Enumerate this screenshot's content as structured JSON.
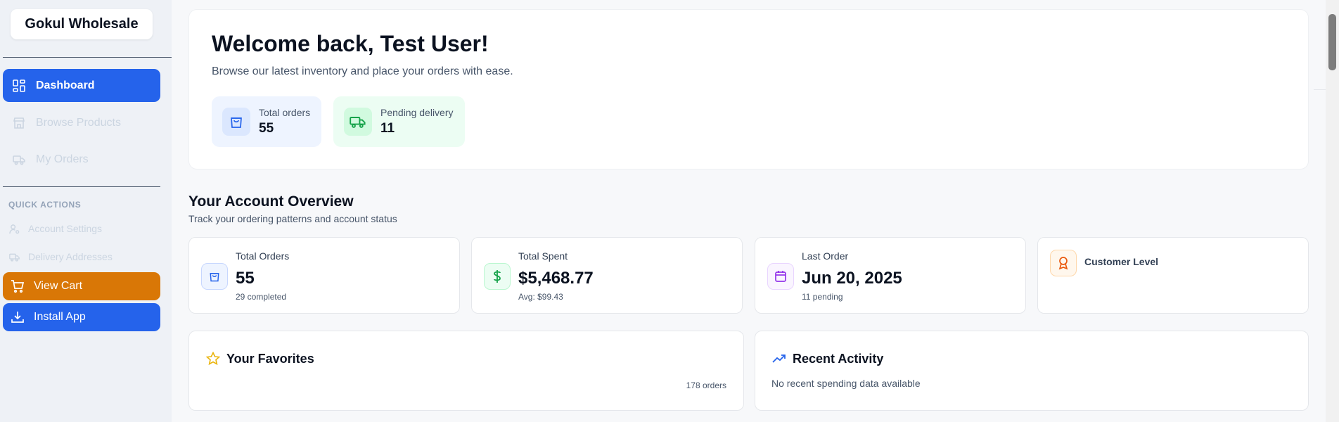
{
  "sidebar": {
    "brand": "Gokul Wholesale",
    "nav": [
      {
        "label": "Dashboard",
        "icon": "dashboard-grid-icon",
        "active": true
      },
      {
        "label": "Browse Products",
        "icon": "store-icon",
        "active": false
      },
      {
        "label": "My Orders",
        "icon": "truck-icon",
        "active": false
      }
    ],
    "quick_actions_title": "QUICK ACTIONS",
    "quick_actions": [
      {
        "label": "Account Settings",
        "icon": "user-settings-icon"
      },
      {
        "label": "Delivery Addresses",
        "icon": "truck-icon"
      }
    ],
    "view_cart": "View Cart",
    "install_app": "Install App"
  },
  "welcome": {
    "title": "Welcome back, Test User!",
    "subtitle": "Browse our latest inventory and place your orders with ease.",
    "stats": [
      {
        "label": "Total orders",
        "value": "55",
        "icon": "shopping-bag-icon"
      },
      {
        "label": "Pending delivery",
        "value": "11",
        "icon": "truck-icon"
      }
    ]
  },
  "overview": {
    "title": "Your Account Overview",
    "subtitle": "Track your ordering patterns and account status",
    "cards": [
      {
        "label": "Total Orders",
        "value": "55",
        "sub": "29 completed",
        "icon": "shopping-bag-icon"
      },
      {
        "label": "Total Spent",
        "value": "$5,468.77",
        "sub": "Avg: $99.43",
        "icon": "dollar-icon"
      },
      {
        "label": "Last Order",
        "value": "Jun 20, 2025",
        "sub": "11 pending",
        "icon": "calendar-icon"
      },
      {
        "label": "Customer Level",
        "value": "",
        "sub": "",
        "icon": "award-icon"
      }
    ]
  },
  "favorites": {
    "title": "Your Favorites",
    "count_text": "178 orders"
  },
  "activity": {
    "title": "Recent Activity",
    "empty_text": "No recent spending data available"
  },
  "colors": {
    "primary": "#2563eb",
    "orange": "#d97706",
    "green": "#16a34a",
    "purple": "#9333ea"
  }
}
